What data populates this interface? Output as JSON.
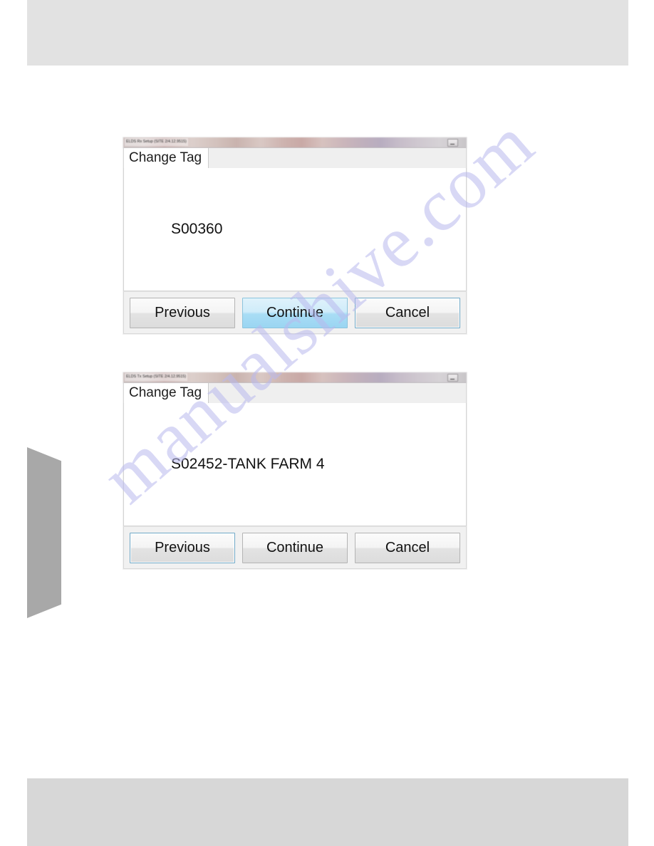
{
  "page": {
    "background_color": "#ffffff",
    "band_color": "#e2e2e2",
    "footer_band_color": "#d7d7d7",
    "watermark_text": "manualshive.com",
    "watermark_color": "#b9b9ee"
  },
  "windows": [
    {
      "title": "ELDS Rx Setup (SITE 2/4.12.9515)",
      "minimize_icon": "minimize-icon",
      "tab_label": "Change Tag",
      "tag_value": "S00360",
      "buttons": [
        {
          "label": "Previous",
          "state": "normal"
        },
        {
          "label": "Continue",
          "state": "accent"
        },
        {
          "label": "Cancel",
          "state": "outlined"
        }
      ]
    },
    {
      "title": "ELDS Tx Setup (SITE 2/4.12.9515)",
      "minimize_icon": "minimize-icon",
      "tab_label": "Change Tag",
      "tag_value": "S02452-TANK FARM 4",
      "buttons": [
        {
          "label": "Previous",
          "state": "focused"
        },
        {
          "label": "Continue",
          "state": "normal"
        },
        {
          "label": "Cancel",
          "state": "normal"
        }
      ]
    }
  ]
}
